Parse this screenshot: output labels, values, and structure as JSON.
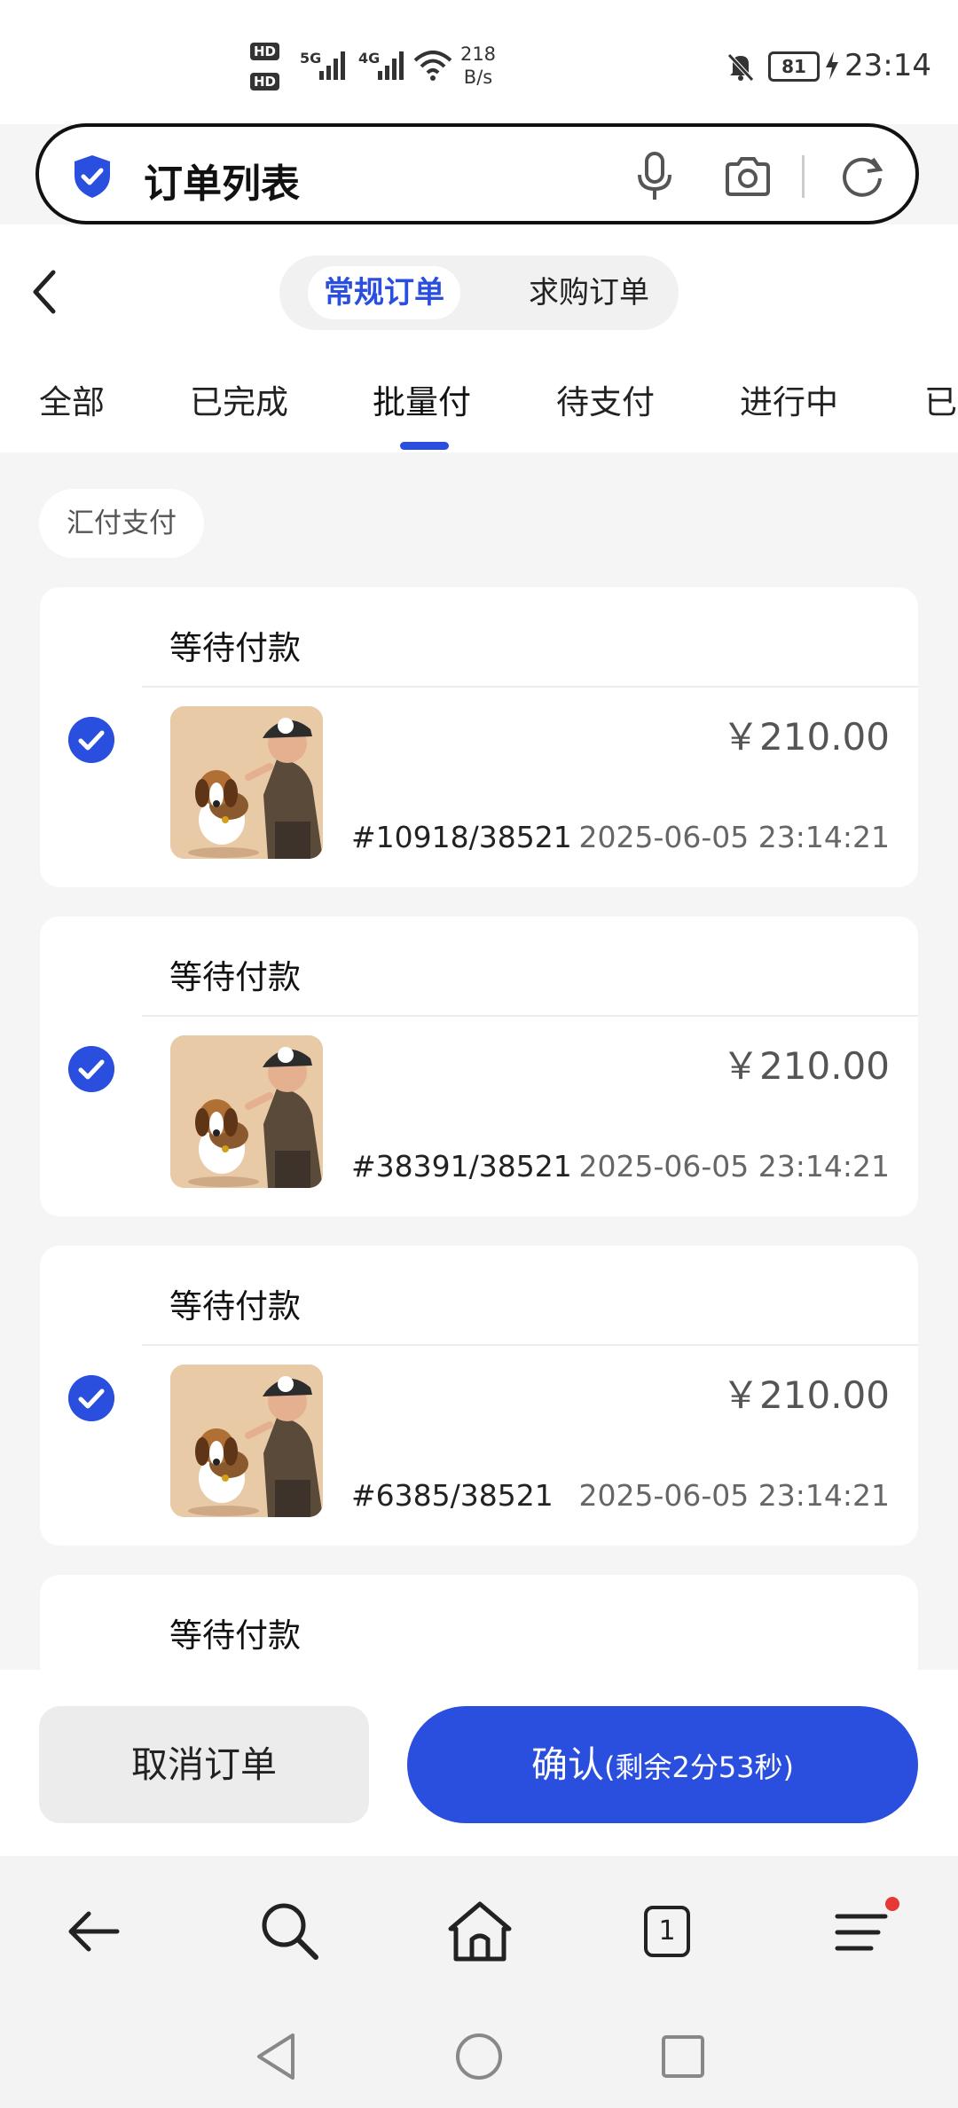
{
  "status_bar": {
    "hd1": "HD",
    "hd2": "HD",
    "sim1": "5G",
    "sim2": "4G",
    "speed_value": "218",
    "speed_unit": "B/s",
    "battery": "81",
    "time": "23:14"
  },
  "search": {
    "title": "订单列表",
    "icons": [
      "shield-icon",
      "mic-icon",
      "camera-icon",
      "refresh-icon"
    ]
  },
  "segments": {
    "active": "常规订单",
    "other": "求购订单"
  },
  "tabs": [
    "全部",
    "已完成",
    "批量付",
    "待支付",
    "进行中",
    "已"
  ],
  "active_tab_index": 2,
  "filter_chip": "汇付支付",
  "orders": [
    {
      "status": "等待付款",
      "price": "￥210.00",
      "order_no": "#10918/38521",
      "time": "2025-06-05 23:14:21",
      "checked": true
    },
    {
      "status": "等待付款",
      "price": "￥210.00",
      "order_no": "#38391/38521",
      "time": "2025-06-05 23:14:21",
      "checked": true
    },
    {
      "status": "等待付款",
      "price": "￥210.00",
      "order_no": "#6385/38521",
      "time": "2025-06-05 23:14:21",
      "checked": true
    },
    {
      "status": "等待付款"
    }
  ],
  "actions": {
    "cancel": "取消订单",
    "confirm": "确认",
    "countdown": "(剩余2分53秒)"
  },
  "browser_nav": {
    "tab_count": "1"
  },
  "colors": {
    "accent": "#2a4fde",
    "background": "#f5f5f5",
    "card": "#ffffff"
  }
}
